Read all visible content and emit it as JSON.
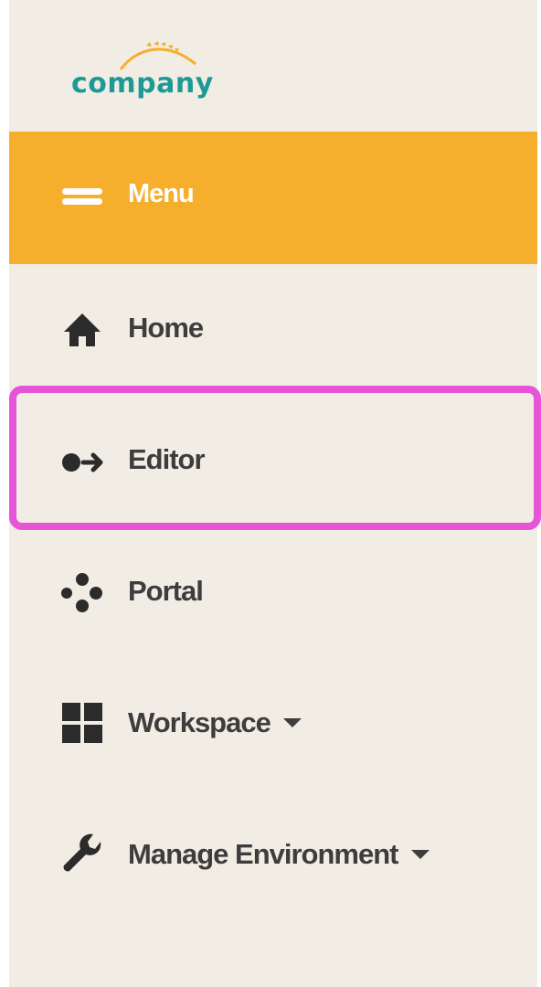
{
  "logo": {
    "text": "company",
    "icon": "wheat-swoosh-icon",
    "text_color": "#1e9a96",
    "swoosh_color": "#f6ae2d"
  },
  "menu": {
    "label": "Menu",
    "icon": "hamburger-icon",
    "background": "#f6ae2d"
  },
  "nav": {
    "items": [
      {
        "label": "Home",
        "icon": "home-icon",
        "has_dropdown": false
      },
      {
        "label": "Editor",
        "icon": "sign-in-icon",
        "has_dropdown": false,
        "highlighted": true
      },
      {
        "label": "Portal",
        "icon": "dots-cluster-icon",
        "has_dropdown": false
      },
      {
        "label": "Workspace",
        "icon": "grid-icon",
        "has_dropdown": true
      },
      {
        "label": "Manage Environment",
        "icon": "wrench-icon",
        "has_dropdown": true
      }
    ]
  },
  "colors": {
    "sidebar_background": "#f1ede4",
    "text": "#3d3d3d",
    "highlight_border": "#e655d8"
  }
}
